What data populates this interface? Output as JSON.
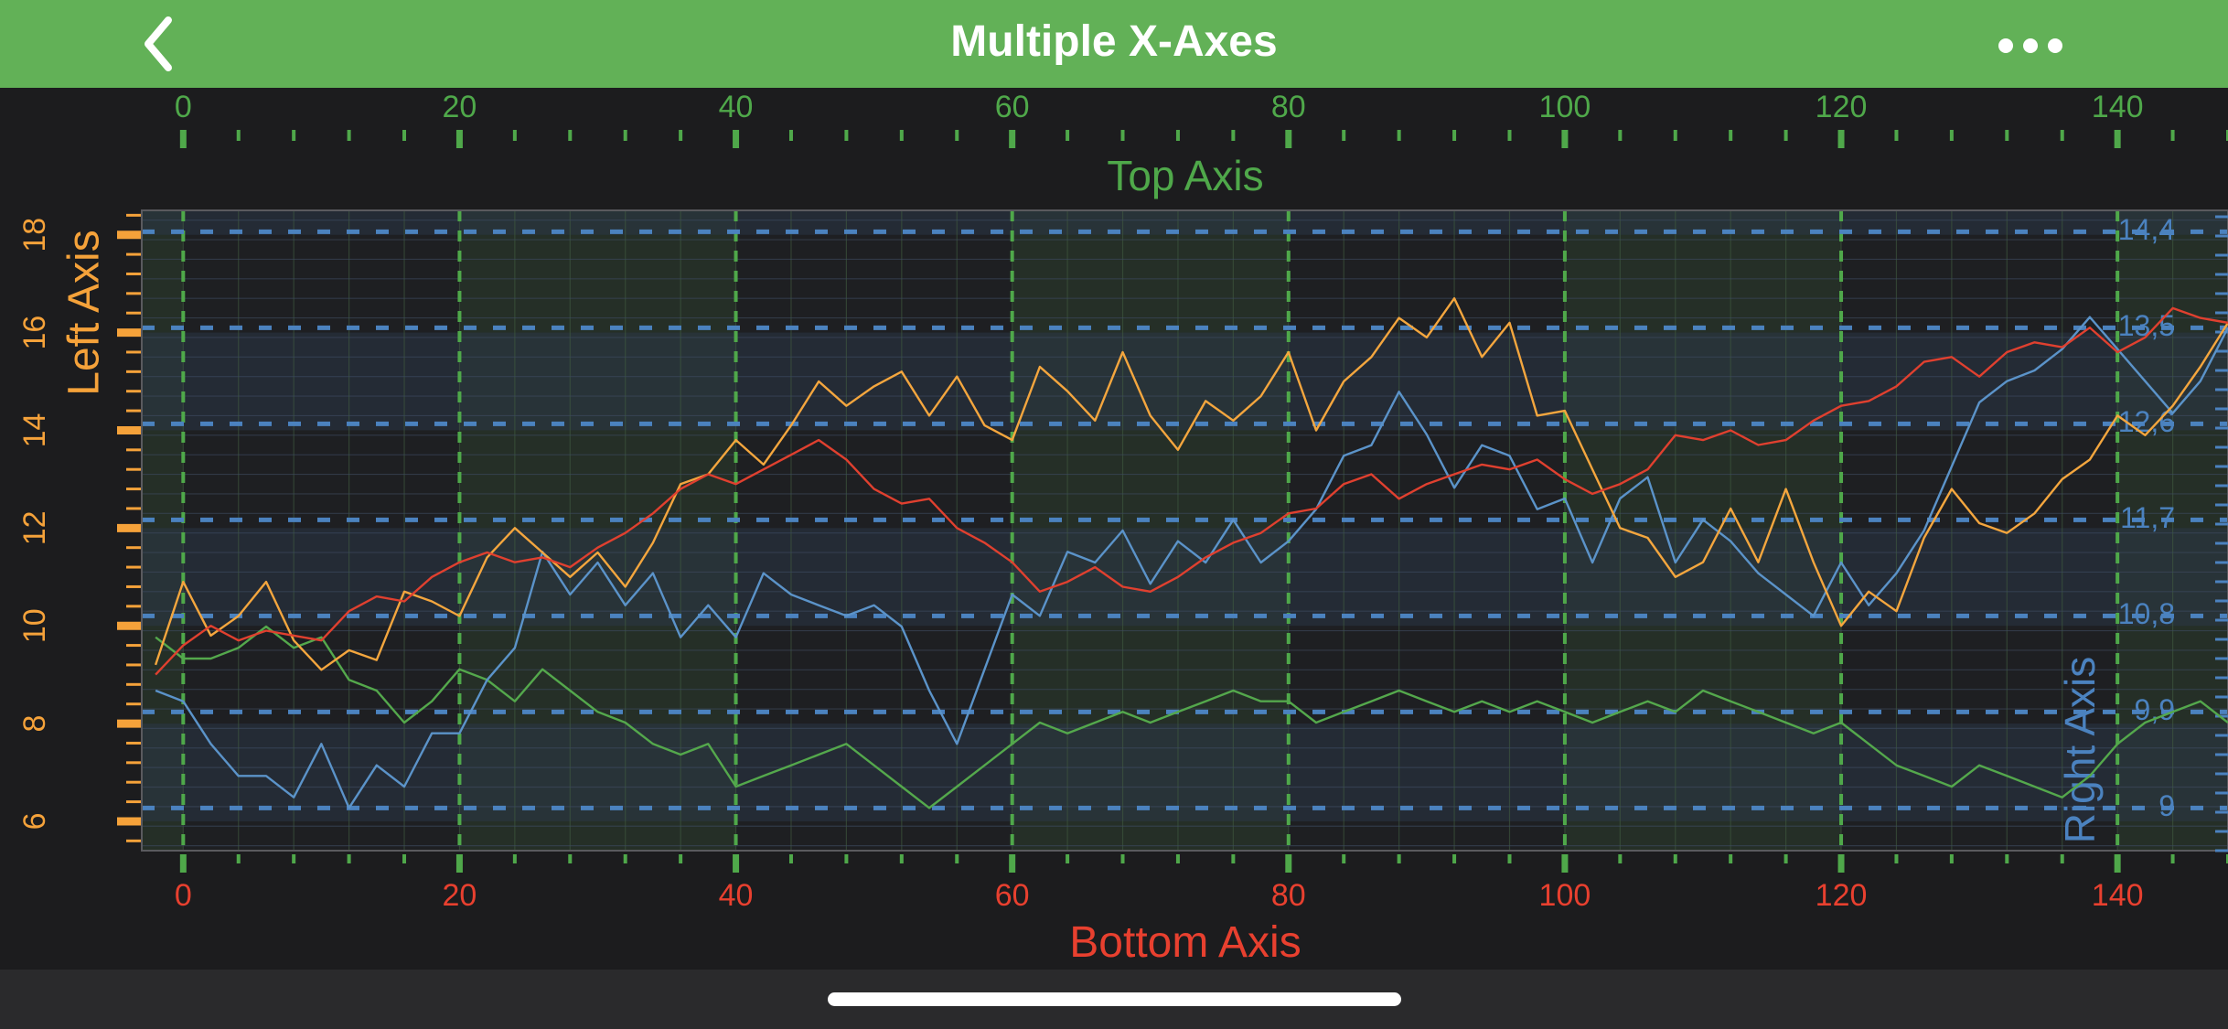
{
  "app": {
    "title": "Multiple X-Axes"
  },
  "icons": {
    "back": "chevron-left-icon",
    "more": "ellipsis-icon"
  },
  "colors": {
    "nav": "#62b157",
    "top": "#4fa84a",
    "bottom": "#e8402f",
    "left": "#f5a23a",
    "right": "#4b82bf",
    "green_series": "#54a84c",
    "blue_series": "#5b93c9",
    "orange_series": "#f4a63e",
    "red_series": "#e0402f"
  },
  "chart_data": {
    "type": "line",
    "axes": {
      "top": {
        "title": "Top Axis",
        "range": [
          -3,
          148
        ],
        "ticks": [
          0,
          20,
          40,
          60,
          80,
          100,
          120,
          140
        ]
      },
      "bottom": {
        "title": "Bottom Axis",
        "range": [
          -3,
          148
        ],
        "ticks": [
          0,
          20,
          40,
          60,
          80,
          100,
          120,
          140
        ]
      },
      "left": {
        "title": "Left Axis",
        "range": [
          5.4,
          18.5
        ],
        "ticks": [
          6,
          8,
          10,
          12,
          14,
          16,
          18
        ]
      },
      "right": {
        "title": "Right Axis",
        "range": [
          8.6,
          14.6
        ],
        "ticks": [
          9,
          9.9,
          10.8,
          11.7,
          12.6,
          13.5,
          14.4
        ],
        "tick_labels": [
          "9",
          "9,9",
          "10,8",
          "11,7",
          "12,6",
          "13,5",
          "14,4"
        ]
      }
    },
    "grid": true,
    "series": [
      {
        "color": "#e0402f",
        "x_axis": "bottom",
        "y_axis": "left",
        "points": [
          [
            -2,
            9.0
          ],
          [
            0,
            9.6
          ],
          [
            2,
            10.0
          ],
          [
            4,
            9.7
          ],
          [
            6,
            9.9
          ],
          [
            8,
            9.8
          ],
          [
            10,
            9.7
          ],
          [
            12,
            10.3
          ],
          [
            14,
            10.6
          ],
          [
            16,
            10.5
          ],
          [
            18,
            11.0
          ],
          [
            20,
            11.3
          ],
          [
            22,
            11.5
          ],
          [
            24,
            11.3
          ],
          [
            26,
            11.4
          ],
          [
            28,
            11.2
          ],
          [
            30,
            11.6
          ],
          [
            32,
            11.9
          ],
          [
            34,
            12.3
          ],
          [
            36,
            12.8
          ],
          [
            38,
            13.1
          ],
          [
            40,
            12.9
          ],
          [
            42,
            13.2
          ],
          [
            44,
            13.5
          ],
          [
            46,
            13.8
          ],
          [
            48,
            13.4
          ],
          [
            50,
            12.8
          ],
          [
            52,
            12.5
          ],
          [
            54,
            12.6
          ],
          [
            56,
            12.0
          ],
          [
            58,
            11.7
          ],
          [
            60,
            11.3
          ],
          [
            62,
            10.7
          ],
          [
            64,
            10.9
          ],
          [
            66,
            11.2
          ],
          [
            68,
            10.8
          ],
          [
            70,
            10.7
          ],
          [
            72,
            11.0
          ],
          [
            74,
            11.4
          ],
          [
            76,
            11.7
          ],
          [
            78,
            11.9
          ],
          [
            80,
            12.3
          ],
          [
            82,
            12.4
          ],
          [
            84,
            12.9
          ],
          [
            86,
            13.1
          ],
          [
            88,
            12.6
          ],
          [
            90,
            12.9
          ],
          [
            92,
            13.1
          ],
          [
            94,
            13.3
          ],
          [
            96,
            13.2
          ],
          [
            98,
            13.4
          ],
          [
            100,
            13.0
          ],
          [
            102,
            12.7
          ],
          [
            104,
            12.9
          ],
          [
            106,
            13.2
          ],
          [
            108,
            13.9
          ],
          [
            110,
            13.8
          ],
          [
            112,
            14.0
          ],
          [
            114,
            13.7
          ],
          [
            116,
            13.8
          ],
          [
            118,
            14.2
          ],
          [
            120,
            14.5
          ],
          [
            122,
            14.6
          ],
          [
            124,
            14.9
          ],
          [
            126,
            15.4
          ],
          [
            128,
            15.5
          ],
          [
            130,
            15.1
          ],
          [
            132,
            15.6
          ],
          [
            134,
            15.8
          ],
          [
            136,
            15.7
          ],
          [
            138,
            16.1
          ],
          [
            140,
            15.6
          ],
          [
            142,
            15.9
          ],
          [
            144,
            16.5
          ],
          [
            146,
            16.3
          ],
          [
            148,
            16.2
          ]
        ]
      },
      {
        "color": "#f4a63e",
        "x_axis": "top",
        "y_axis": "left",
        "points": [
          [
            -2,
            9.2
          ],
          [
            0,
            10.9
          ],
          [
            2,
            9.8
          ],
          [
            4,
            10.2
          ],
          [
            6,
            10.9
          ],
          [
            8,
            9.7
          ],
          [
            10,
            9.1
          ],
          [
            12,
            9.5
          ],
          [
            14,
            9.3
          ],
          [
            16,
            10.7
          ],
          [
            18,
            10.5
          ],
          [
            20,
            10.2
          ],
          [
            22,
            11.4
          ],
          [
            24,
            12.0
          ],
          [
            26,
            11.5
          ],
          [
            28,
            11.0
          ],
          [
            30,
            11.5
          ],
          [
            32,
            10.8
          ],
          [
            34,
            11.7
          ],
          [
            36,
            12.9
          ],
          [
            38,
            13.1
          ],
          [
            40,
            13.8
          ],
          [
            42,
            13.3
          ],
          [
            44,
            14.1
          ],
          [
            46,
            15.0
          ],
          [
            48,
            14.5
          ],
          [
            50,
            14.9
          ],
          [
            52,
            15.2
          ],
          [
            54,
            14.3
          ],
          [
            56,
            15.1
          ],
          [
            58,
            14.1
          ],
          [
            60,
            13.8
          ],
          [
            62,
            15.3
          ],
          [
            64,
            14.8
          ],
          [
            66,
            14.2
          ],
          [
            68,
            15.6
          ],
          [
            70,
            14.3
          ],
          [
            72,
            13.6
          ],
          [
            74,
            14.6
          ],
          [
            76,
            14.2
          ],
          [
            78,
            14.7
          ],
          [
            80,
            15.6
          ],
          [
            82,
            14.0
          ],
          [
            84,
            15.0
          ],
          [
            86,
            15.5
          ],
          [
            88,
            16.3
          ],
          [
            90,
            15.9
          ],
          [
            92,
            16.7
          ],
          [
            94,
            15.5
          ],
          [
            96,
            16.2
          ],
          [
            98,
            14.3
          ],
          [
            100,
            14.4
          ],
          [
            102,
            13.2
          ],
          [
            104,
            12.0
          ],
          [
            106,
            11.8
          ],
          [
            108,
            11.0
          ],
          [
            110,
            11.3
          ],
          [
            112,
            12.4
          ],
          [
            114,
            11.3
          ],
          [
            116,
            12.8
          ],
          [
            118,
            11.3
          ],
          [
            120,
            10.0
          ],
          [
            122,
            10.7
          ],
          [
            124,
            10.3
          ],
          [
            126,
            11.8
          ],
          [
            128,
            12.8
          ],
          [
            130,
            12.1
          ],
          [
            132,
            11.9
          ],
          [
            134,
            12.3
          ],
          [
            136,
            13.0
          ],
          [
            138,
            13.4
          ],
          [
            140,
            14.3
          ],
          [
            142,
            13.9
          ],
          [
            144,
            14.5
          ],
          [
            146,
            15.3
          ],
          [
            148,
            16.2
          ]
        ]
      },
      {
        "color": "#5b93c9",
        "x_axis": "bottom",
        "y_axis": "right",
        "points": [
          [
            -2,
            10.1
          ],
          [
            0,
            10.0
          ],
          [
            2,
            9.6
          ],
          [
            4,
            9.3
          ],
          [
            6,
            9.3
          ],
          [
            8,
            9.1
          ],
          [
            10,
            9.6
          ],
          [
            12,
            9.0
          ],
          [
            14,
            9.4
          ],
          [
            16,
            9.2
          ],
          [
            18,
            9.7
          ],
          [
            20,
            9.7
          ],
          [
            22,
            10.2
          ],
          [
            24,
            10.5
          ],
          [
            26,
            11.4
          ],
          [
            28,
            11.0
          ],
          [
            30,
            11.3
          ],
          [
            32,
            10.9
          ],
          [
            34,
            11.2
          ],
          [
            36,
            10.6
          ],
          [
            38,
            10.9
          ],
          [
            40,
            10.6
          ],
          [
            42,
            11.2
          ],
          [
            44,
            11.0
          ],
          [
            46,
            10.9
          ],
          [
            48,
            10.8
          ],
          [
            50,
            10.9
          ],
          [
            52,
            10.7
          ],
          [
            54,
            10.1
          ],
          [
            56,
            9.6
          ],
          [
            58,
            10.3
          ],
          [
            60,
            11.0
          ],
          [
            62,
            10.8
          ],
          [
            64,
            11.4
          ],
          [
            66,
            11.3
          ],
          [
            68,
            11.6
          ],
          [
            70,
            11.1
          ],
          [
            72,
            11.5
          ],
          [
            74,
            11.3
          ],
          [
            76,
            11.7
          ],
          [
            78,
            11.3
          ],
          [
            80,
            11.5
          ],
          [
            82,
            11.8
          ],
          [
            84,
            12.3
          ],
          [
            86,
            12.4
          ],
          [
            88,
            12.9
          ],
          [
            90,
            12.5
          ],
          [
            92,
            12.0
          ],
          [
            94,
            12.4
          ],
          [
            96,
            12.3
          ],
          [
            98,
            11.8
          ],
          [
            100,
            11.9
          ],
          [
            102,
            11.3
          ],
          [
            104,
            11.9
          ],
          [
            106,
            12.1
          ],
          [
            108,
            11.3
          ],
          [
            110,
            11.7
          ],
          [
            112,
            11.5
          ],
          [
            114,
            11.2
          ],
          [
            116,
            11.0
          ],
          [
            118,
            10.8
          ],
          [
            120,
            11.3
          ],
          [
            122,
            10.9
          ],
          [
            124,
            11.2
          ],
          [
            126,
            11.6
          ],
          [
            128,
            12.2
          ],
          [
            130,
            12.8
          ],
          [
            132,
            13.0
          ],
          [
            134,
            13.1
          ],
          [
            136,
            13.3
          ],
          [
            138,
            13.6
          ],
          [
            140,
            13.3
          ],
          [
            142,
            13.0
          ],
          [
            144,
            12.7
          ],
          [
            146,
            13.0
          ],
          [
            148,
            13.5
          ]
        ]
      },
      {
        "color": "#54a84c",
        "x_axis": "top",
        "y_axis": "right",
        "points": [
          [
            -2,
            10.6
          ],
          [
            0,
            10.4
          ],
          [
            2,
            10.4
          ],
          [
            4,
            10.5
          ],
          [
            6,
            10.7
          ],
          [
            8,
            10.5
          ],
          [
            10,
            10.6
          ],
          [
            12,
            10.2
          ],
          [
            14,
            10.1
          ],
          [
            16,
            9.8
          ],
          [
            18,
            10.0
          ],
          [
            20,
            10.3
          ],
          [
            22,
            10.2
          ],
          [
            24,
            10.0
          ],
          [
            26,
            10.3
          ],
          [
            28,
            10.1
          ],
          [
            30,
            9.9
          ],
          [
            32,
            9.8
          ],
          [
            34,
            9.6
          ],
          [
            36,
            9.5
          ],
          [
            38,
            9.6
          ],
          [
            40,
            9.2
          ],
          [
            42,
            9.3
          ],
          [
            44,
            9.4
          ],
          [
            46,
            9.5
          ],
          [
            48,
            9.6
          ],
          [
            50,
            9.4
          ],
          [
            52,
            9.2
          ],
          [
            54,
            9.0
          ],
          [
            56,
            9.2
          ],
          [
            58,
            9.4
          ],
          [
            60,
            9.6
          ],
          [
            62,
            9.8
          ],
          [
            64,
            9.7
          ],
          [
            66,
            9.8
          ],
          [
            68,
            9.9
          ],
          [
            70,
            9.8
          ],
          [
            72,
            9.9
          ],
          [
            74,
            10.0
          ],
          [
            76,
            10.1
          ],
          [
            78,
            10.0
          ],
          [
            80,
            10.0
          ],
          [
            82,
            9.8
          ],
          [
            84,
            9.9
          ],
          [
            86,
            10.0
          ],
          [
            88,
            10.1
          ],
          [
            90,
            10.0
          ],
          [
            92,
            9.9
          ],
          [
            94,
            10.0
          ],
          [
            96,
            9.9
          ],
          [
            98,
            10.0
          ],
          [
            100,
            9.9
          ],
          [
            102,
            9.8
          ],
          [
            104,
            9.9
          ],
          [
            106,
            10.0
          ],
          [
            108,
            9.9
          ],
          [
            110,
            10.1
          ],
          [
            112,
            10.0
          ],
          [
            114,
            9.9
          ],
          [
            116,
            9.8
          ],
          [
            118,
            9.7
          ],
          [
            120,
            9.8
          ],
          [
            122,
            9.6
          ],
          [
            124,
            9.4
          ],
          [
            126,
            9.3
          ],
          [
            128,
            9.2
          ],
          [
            130,
            9.4
          ],
          [
            132,
            9.3
          ],
          [
            134,
            9.2
          ],
          [
            136,
            9.1
          ],
          [
            138,
            9.3
          ],
          [
            140,
            9.6
          ],
          [
            142,
            9.8
          ],
          [
            144,
            9.9
          ],
          [
            146,
            10.0
          ],
          [
            148,
            9.8
          ]
        ]
      }
    ]
  }
}
